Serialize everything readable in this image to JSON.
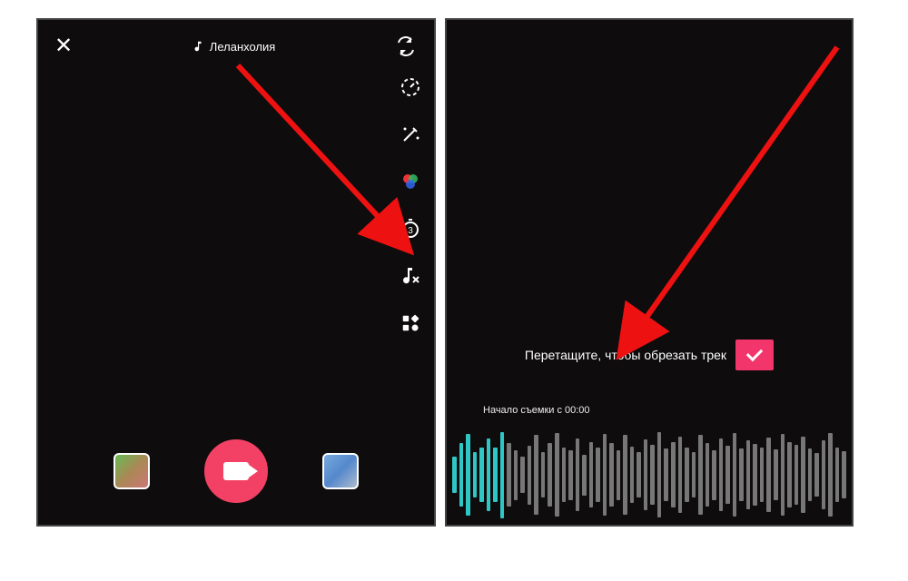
{
  "left": {
    "sound_label": "Леланхолия",
    "icons": {
      "close": "close-icon",
      "note": "music-note-icon",
      "flip": "flip-camera-icon",
      "speed": "speed-icon",
      "beauty": "magic-wand-icon",
      "filters": "color-balls-icon",
      "timer": "timer-3-icon",
      "cut_sound": "music-cut-icon",
      "more": "more-grid-icon"
    },
    "bottom": {
      "effects_thumb": "effects-thumb",
      "record": "record-button",
      "gallery_thumb": "gallery-thumb"
    }
  },
  "right": {
    "trim_text": "Перетащите, чтобы обрезать трек",
    "start_label": "Начало съемки с 00:00",
    "waveform_heights": [
      40,
      70,
      90,
      50,
      60,
      80,
      60,
      95,
      70,
      55,
      40,
      65,
      88,
      50,
      70,
      92,
      60,
      55,
      80,
      45,
      72,
      60,
      90,
      70,
      55,
      88,
      62,
      50,
      78,
      66,
      94,
      58,
      72,
      84,
      60,
      50,
      88,
      70,
      55,
      80,
      64,
      92,
      58,
      76,
      68,
      60,
      82,
      56,
      90,
      72,
      66,
      84,
      58,
      48,
      76,
      92,
      60,
      52
    ],
    "active_bars": 8,
    "colors": {
      "accent": "#f2356a",
      "wave_active": "#2fc6c6"
    }
  }
}
